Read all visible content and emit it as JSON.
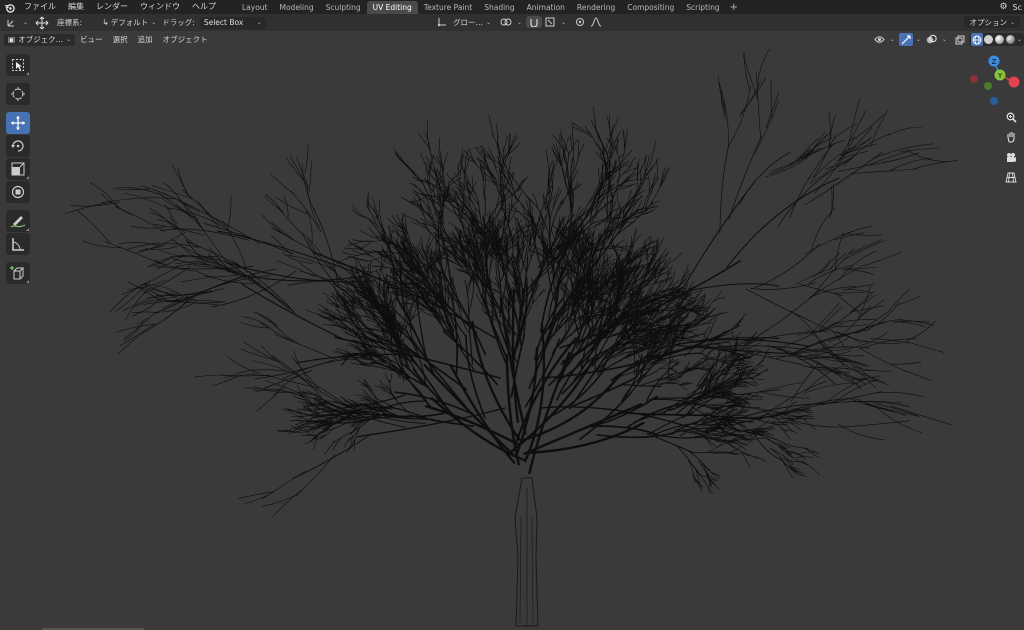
{
  "topbar": {
    "menu": [
      "ファイル",
      "編集",
      "レンダー",
      "ウィンドウ",
      "ヘルプ"
    ],
    "tabs": [
      {
        "label": "Layout",
        "active": false
      },
      {
        "label": "Modeling",
        "active": false
      },
      {
        "label": "Sculpting",
        "active": false
      },
      {
        "label": "UV Editing",
        "active": true
      },
      {
        "label": "Texture Paint",
        "active": false
      },
      {
        "label": "Shading",
        "active": false
      },
      {
        "label": "Animation",
        "active": false
      },
      {
        "label": "Rendering",
        "active": false
      },
      {
        "label": "Compositing",
        "active": false
      },
      {
        "label": "Scripting",
        "active": false
      }
    ],
    "add_tab": "+",
    "scene_label": "Sc"
  },
  "toolheader": {
    "orientation_label": "座標系:",
    "orientation_value": "デフォルト",
    "drag_label": "ドラッグ:",
    "drag_value": "Select Box",
    "transform_orientation": "グロー…",
    "options_label": "オプション"
  },
  "viewport_header": {
    "mode": "オブジェク…",
    "menu": [
      "ビュー",
      "選択",
      "追加",
      "オブジェクト"
    ]
  },
  "toolbar": {
    "tools": [
      {
        "name": "select-box-tool",
        "icon": "select-box-icon",
        "active": false
      },
      {
        "name": "cursor-tool",
        "icon": "cursor-icon",
        "active": false
      },
      {
        "name": "move-tool",
        "icon": "move-icon",
        "active": true
      },
      {
        "name": "rotate-tool",
        "icon": "rotate-icon",
        "active": false
      },
      {
        "name": "scale-tool",
        "icon": "scale-icon",
        "active": false
      },
      {
        "name": "transform-tool",
        "icon": "transform-icon",
        "active": false
      },
      {
        "name": "annotate-tool",
        "icon": "annotate-icon",
        "active": false
      },
      {
        "name": "measure-tool",
        "icon": "measure-icon",
        "active": false
      },
      {
        "name": "add-cube-tool",
        "icon": "add-cube-icon",
        "active": false
      }
    ]
  },
  "gizmo": {
    "z_label": "Z",
    "y_label": "Y"
  },
  "colors": {
    "accent": "#4772b3",
    "viewport_bg": "#3a3a3a",
    "x_axis": "#e0444f",
    "y_axis": "#84c43a",
    "z_axis": "#3a8ce0",
    "branch": "#0e0e0e"
  }
}
